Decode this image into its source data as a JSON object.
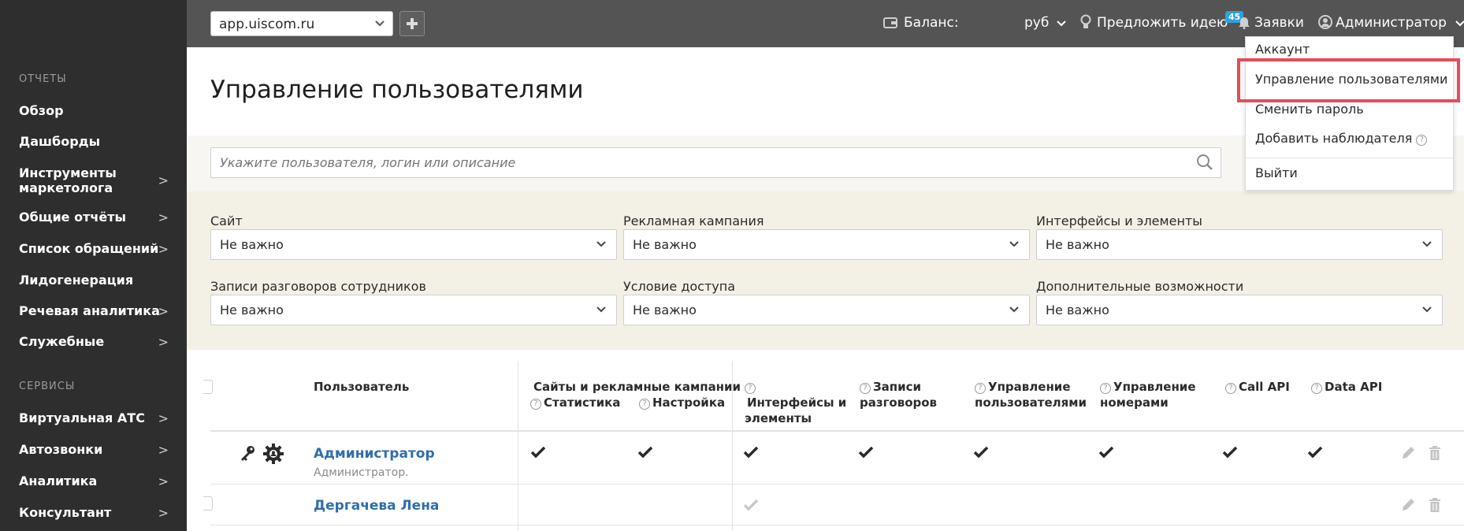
{
  "topbar": {
    "site": "app.uiscom.ru",
    "balance_label": "Баланс:",
    "currency": "руб",
    "suggest": "Предложить идею",
    "requests_badge": "45",
    "requests": "Заявки",
    "user": "Администратор"
  },
  "sidebar": {
    "section_reports": "ОТЧЕТЫ",
    "section_services": "СЕРВИСЫ",
    "items": [
      {
        "label": "Обзор"
      },
      {
        "label": "Дашборды"
      },
      {
        "label": "Инструменты маркетолога",
        "arrow": ">"
      },
      {
        "label": "Общие отчёты",
        "arrow": ">"
      },
      {
        "label": "Список обращений",
        "arrow": ">"
      },
      {
        "label": "Лидогенерация"
      },
      {
        "label": "Речевая аналитика",
        "arrow": ">"
      },
      {
        "label": "Служебные",
        "arrow": ">"
      },
      {
        "label": "Виртуальная АТС",
        "arrow": ">"
      },
      {
        "label": "Автозвонки",
        "arrow": ">"
      },
      {
        "label": "Аналитика",
        "arrow": ">"
      },
      {
        "label": "Консультант",
        "arrow": ">"
      }
    ]
  },
  "page": {
    "title": "Управление пользователями",
    "search_placeholder": "Укажите пользователя, логин или описание"
  },
  "filters": [
    {
      "label": "Сайт",
      "value": "Не важно"
    },
    {
      "label": "Рекламная кампания",
      "value": "Не важно"
    },
    {
      "label": "Интерфейсы и элементы",
      "value": "Не важно"
    },
    {
      "label": "Записи разговоров сотрудников",
      "value": "Не важно"
    },
    {
      "label": "Условие доступа",
      "value": "Не важно"
    },
    {
      "label": "Дополнительные возможности",
      "value": "Не важно"
    }
  ],
  "table": {
    "col_user": "Пользователь",
    "col_sites_group": "Сайты и рекламные кампании",
    "col_stats": "Статистика",
    "col_settings": "Настройка",
    "col_interfaces_1": "Интерфейсы и",
    "col_interfaces_2": "элементы",
    "col_records_1": "Записи",
    "col_records_2": "разговоров",
    "col_user_mgmt_1": "Управление",
    "col_user_mgmt_2": "пользователями",
    "col_num_mgmt_1": "Управление",
    "col_num_mgmt_2": "номерами",
    "col_call_api": "Call API",
    "col_data_api": "Data API",
    "rows": [
      {
        "name": "Администратор",
        "sub": "Администратор."
      },
      {
        "name": "Дергачева Лена",
        "sub": ""
      }
    ]
  },
  "dropdown": {
    "items": [
      "Аккаунт",
      "Управление пользователями",
      "Сменить пароль",
      "Добавить наблюдателя",
      "Выйти"
    ]
  },
  "colors": {
    "sidebar_bg": "#2e2e2e",
    "topbar_bg": "#545454",
    "link": "#2f6eaa",
    "highlight": "#e84b5b",
    "badge": "#2aa4dc"
  }
}
